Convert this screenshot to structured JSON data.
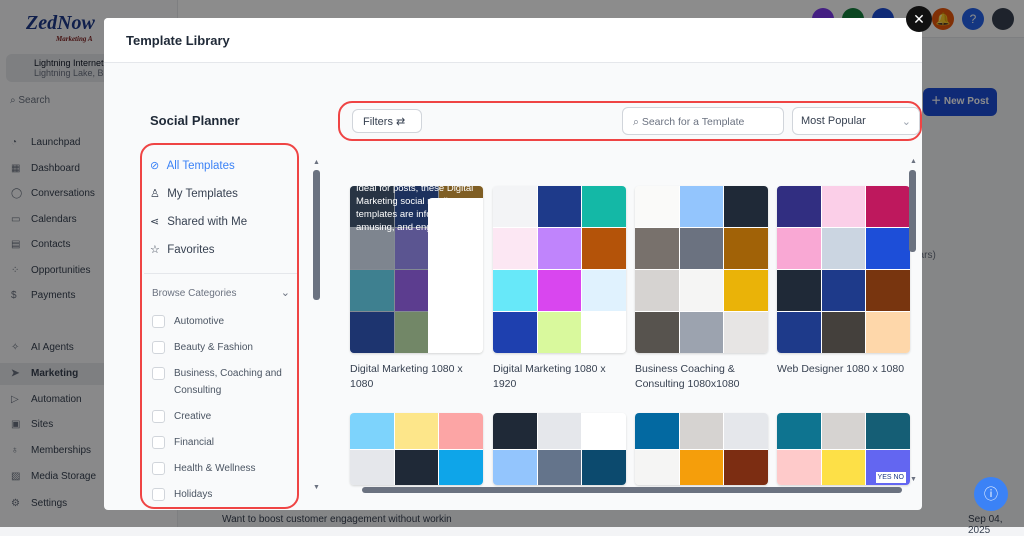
{
  "app": {
    "logo": "ZedNow",
    "logo_tagline": "Marketing A",
    "account_name": "Lightning Internet",
    "account_location": "Lightning Lake, BC",
    "search_placeholder": "Search",
    "nav": [
      {
        "label": "Launchpad",
        "icon": "rocket-icon"
      },
      {
        "label": "Dashboard",
        "icon": "grid-icon"
      },
      {
        "label": "Conversations",
        "icon": "chat-icon"
      },
      {
        "label": "Calendars",
        "icon": "calendar-icon"
      },
      {
        "label": "Contacts",
        "icon": "contacts-icon"
      },
      {
        "label": "Opportunities",
        "icon": "opportunities-icon"
      },
      {
        "label": "Payments",
        "icon": "payments-icon"
      }
    ],
    "nav2": [
      {
        "label": "AI Agents",
        "icon": "sparkle-icon"
      },
      {
        "label": "Marketing",
        "icon": "send-icon",
        "active": true
      },
      {
        "label": "Automation",
        "icon": "automation-icon"
      },
      {
        "label": "Sites",
        "icon": "sites-icon"
      },
      {
        "label": "Memberships",
        "icon": "membership-icon"
      },
      {
        "label": "Media Storage",
        "icon": "media-icon"
      },
      {
        "label": "Settings",
        "icon": "gear-icon"
      }
    ],
    "new_post": "New Post",
    "chars_fragment": "hars)",
    "row_text": "Want to boost customer engagement without workin",
    "row_date": "Sep 04, 2025"
  },
  "modal": {
    "title": "Template Library",
    "sidebar_title": "Social Planner",
    "views": [
      {
        "label": "All Templates",
        "icon": "check-circle-icon",
        "active": true
      },
      {
        "label": "My Templates",
        "icon": "user-icon"
      },
      {
        "label": "Shared with Me",
        "icon": "share-icon"
      },
      {
        "label": "Favorites",
        "icon": "star-icon"
      }
    ],
    "browse_label": "Browse Categories",
    "categories": [
      "Automotive",
      "Beauty & Fashion",
      "Business, Coaching and Consulting",
      "Creative",
      "Financial",
      "Health & Wellness",
      "Holidays"
    ],
    "filters_label": "Filters",
    "search_placeholder": "Search for a Template",
    "sort_value": "Most Popular",
    "templates": [
      {
        "title": "Digital Marketing 1080 x 1080",
        "description": "Ideal for posts, these Digital Marketing social media templates are informative, amusing, and engaging!..."
      },
      {
        "title": "Digital Marketing 1080 x 1920"
      },
      {
        "title": "Business Coaching & Consulting 1080x1080"
      },
      {
        "title": "Web Designer 1080 x 1080"
      }
    ],
    "row2_badge": "YES NO"
  },
  "colors": {
    "accent": "#3b82f6",
    "highlight": "#ef4444",
    "new_post": "#1d4ed8"
  }
}
